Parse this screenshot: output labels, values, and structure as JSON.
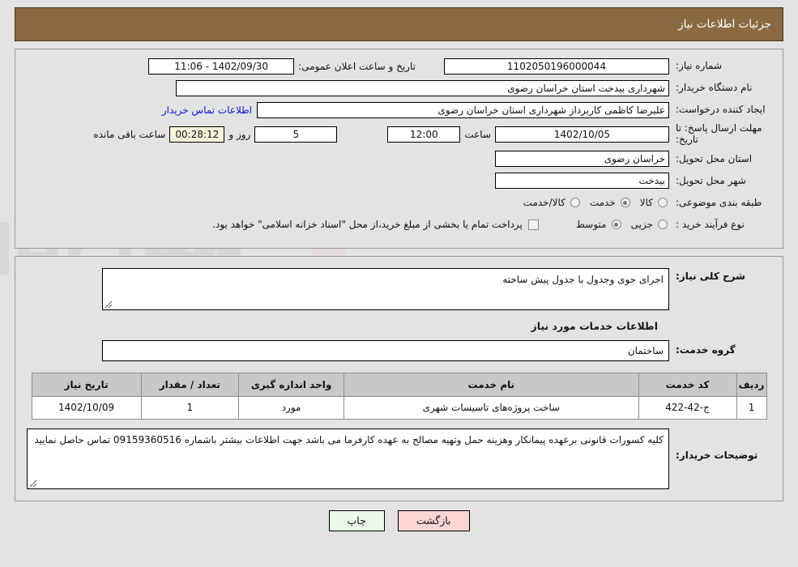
{
  "header": {
    "title": "جزئیات اطلاعات نیاز"
  },
  "colors": {
    "header_bg": "#8a6a42",
    "page_bg": "#e3e3e3",
    "link": "#1414dd",
    "timer_bg": "#f7f7dd",
    "table_header_bg": "#c8c8c8",
    "print_btn_bg": "#e9f8e9",
    "back_btn_bg": "#fbd4d4"
  },
  "top_form": {
    "need_number_label": "شماره نیاز:",
    "need_number_value": "1102050196000044",
    "announce_datetime_label": "تاریخ و ساعت اعلان عمومی:",
    "announce_datetime_value": "1402/09/30 - 11:06",
    "buyer_org_label": "نام دستگاه خریدار:",
    "buyer_org_value": "شهرداری بیدخت استان خراسان رضوی",
    "requester_label": "ایجاد کننده درخواست:",
    "requester_value": "علیرضا کاظمی کاربرداز شهرداری استان خراسان رضوی",
    "contact_link": "اطلاعات تماس خریدار",
    "deadline_label": "مهلت ارسال پاسخ: تا تاریخ:",
    "deadline_date": "1402/10/05",
    "hour_label": "ساعت",
    "deadline_time": "12:00",
    "days_remaining": "5",
    "days_word": "روز و",
    "countdown": "00:28:12",
    "remaining_word": "ساعت باقی مانده",
    "province_label": "استان محل تحویل:",
    "province_value": "خراسان رضوی",
    "city_label": "شهر محل تحویل:",
    "city_value": "بیدخت",
    "category_label": "طبقه بندی موضوعی:",
    "category_options": [
      {
        "label": "کالا",
        "selected": false
      },
      {
        "label": "خدمت",
        "selected": true
      },
      {
        "label": "کالا/خدمت",
        "selected": false
      }
    ],
    "process_label": "نوع فرآیند خرید :",
    "process_options": [
      {
        "label": "جزیی",
        "selected": false
      },
      {
        "label": "متوسط",
        "selected": true
      }
    ],
    "payment_checkbox_checked": false,
    "payment_note": "پرداخت تمام یا بخشی از مبلغ خرید،از محل \"اسناد خزانه اسلامی\" خواهد بود."
  },
  "middle": {
    "general_desc_label": "شرح کلی نیاز:",
    "general_desc_value": "اجرای جوی وجدول با جدول پیش ساخته",
    "services_section_title": "اطلاعات خدمات مورد نیاز",
    "service_group_label": "گروه خدمت:",
    "service_group_value": "ساختمان"
  },
  "table": {
    "columns": [
      "ردیف",
      "کد خدمت",
      "نام خدمت",
      "واحد اندازه گیری",
      "تعداد / مقدار",
      "تاریخ نیاز"
    ],
    "rows": [
      {
        "row_no": "1",
        "service_code": "ج-42-422",
        "service_name": "ساخت پروژه‌های تاسیسات شهری",
        "unit": "مورد",
        "quantity": "1",
        "need_date": "1402/10/09"
      }
    ]
  },
  "buyer_notes": {
    "label": "توضیحات خریدار:",
    "value": "کلیه کسورات قانونی برعهده پیمانکار وهزینه حمل وتهیه مصالح به عهده کارفرما می باشد جهت اطلاعات بیشتر باشماره 09159360516 تماس حاصل نمایید"
  },
  "buttons": {
    "print": "چاپ",
    "back": "بازگشت"
  },
  "watermark": {
    "text": "AriaTender.net"
  }
}
